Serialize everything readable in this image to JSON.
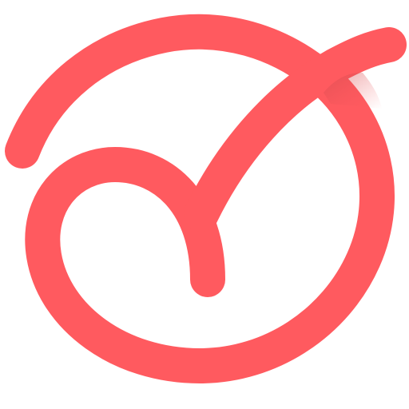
{
  "logo": {
    "icon": "checkmark-swirl-logo-icon",
    "colors": {
      "primary": "#FF5A5F",
      "shadow": "#C9474B",
      "background": "#FFFFFF"
    }
  }
}
